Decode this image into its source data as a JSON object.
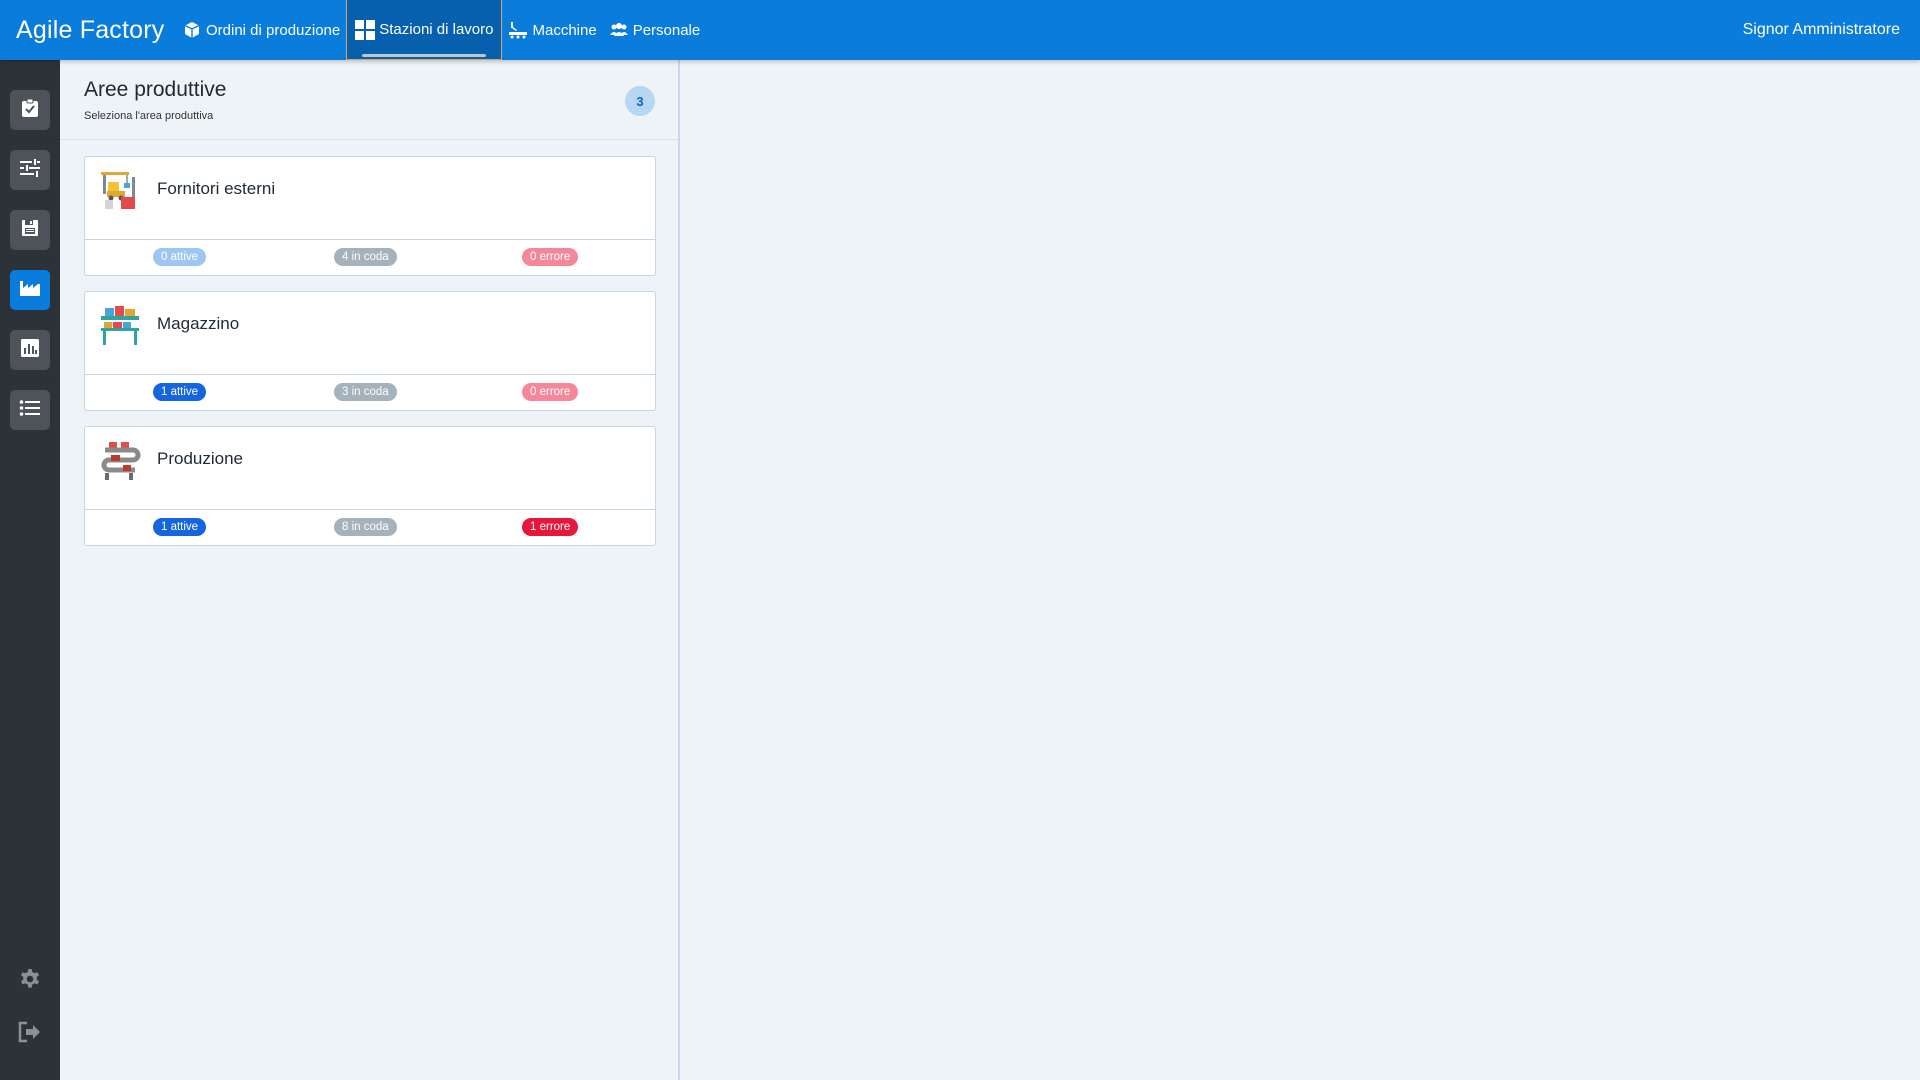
{
  "app": {
    "title": "Agile Factory"
  },
  "nav": {
    "items": [
      {
        "label": "Ordini di produzione",
        "icon": "cube-icon"
      },
      {
        "label": "Stazioni di lavoro",
        "icon": "grid-icon",
        "active": true
      },
      {
        "label": "Macchine",
        "icon": "machine-icon"
      },
      {
        "label": "Personale",
        "icon": "people-icon"
      }
    ]
  },
  "user": {
    "name": "Signor Amministratore"
  },
  "sidebar": {
    "items": [
      {
        "icon": "task-check-icon"
      },
      {
        "icon": "sliders-icon"
      },
      {
        "icon": "save-disk-icon"
      },
      {
        "icon": "factory-icon",
        "active": true
      },
      {
        "icon": "bar-report-icon"
      },
      {
        "icon": "list-icon"
      }
    ],
    "bottom": [
      {
        "icon": "gear-icon"
      },
      {
        "icon": "logout-icon"
      }
    ]
  },
  "panel": {
    "title": "Aree produttive",
    "subtitle": "Seleziona l'area produttiva",
    "count": "3",
    "areas": [
      {
        "name": "Fornitori esterni",
        "active": "0 attive",
        "queue": "4 in coda",
        "errors": "0 errore"
      },
      {
        "name": "Magazzino",
        "active": "1 attive",
        "queue": "3 in coda",
        "errors": "0 errore"
      },
      {
        "name": "Produzione",
        "active": "1 attive",
        "queue": "8 in coda",
        "errors": "1 errore"
      }
    ]
  },
  "colors": {
    "topbar": "#0a7cdc",
    "active_nav": "#0660ae",
    "sidebar": "#2c3338",
    "active_pill": "#1565e0",
    "inactive_pill": "#9ec6f3",
    "queue_pill": "#a5b1bb",
    "error_pill": "#e8163a",
    "error_zero_pill": "#f5879b"
  }
}
